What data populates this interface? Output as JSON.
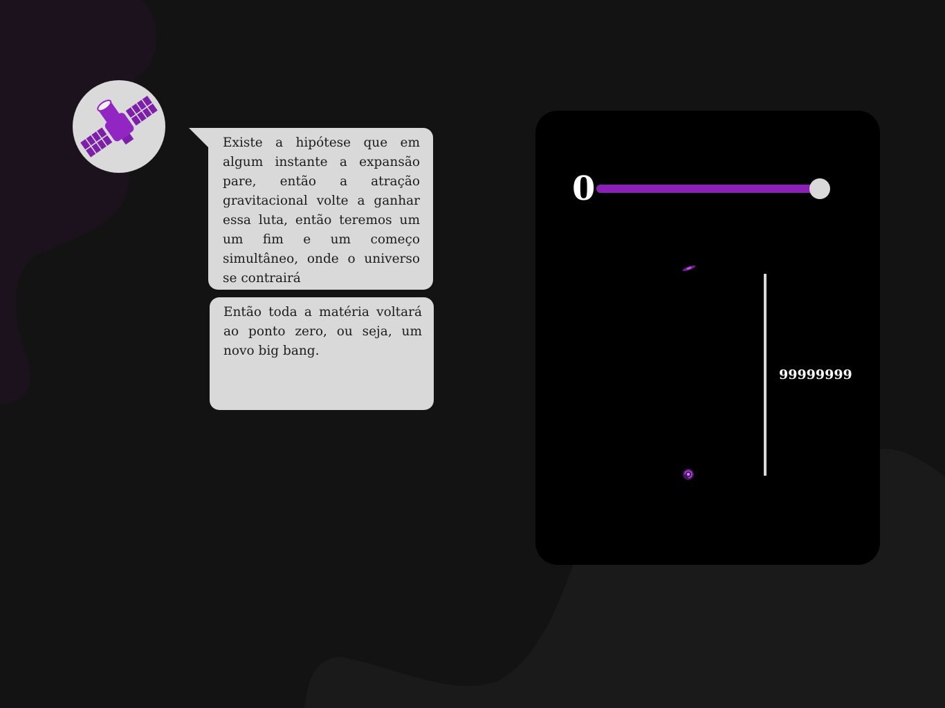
{
  "colors": {
    "background": "#131313",
    "blob_purple": "#1c121e",
    "blob_gray": "#1a1a1a",
    "bubble": "#d9d9d9",
    "accent": "#8b20b6",
    "panel": "#000000",
    "text_dark": "#1c1c1c",
    "text_light": "#ffffff"
  },
  "narrator": {
    "avatar_icon": "satellite-icon"
  },
  "dialogue": {
    "bubble_1": "Existe a hipótese que em algum instante a expansão pare, então a atração gravitacional volte a ganhar essa luta, então teremos um um fim e um começo simultâneo, onde o universo se contrairá",
    "bubble_2": "Então toda a matéria voltará ao ponto zero, ou seja, um novo big bang."
  },
  "simulation": {
    "slider": {
      "value": "0",
      "fill_fraction": 1
    },
    "galaxies": [
      {
        "icon": "galaxy-icon"
      },
      {
        "icon": "galaxy-icon"
      }
    ],
    "distance_label": "99999999"
  }
}
